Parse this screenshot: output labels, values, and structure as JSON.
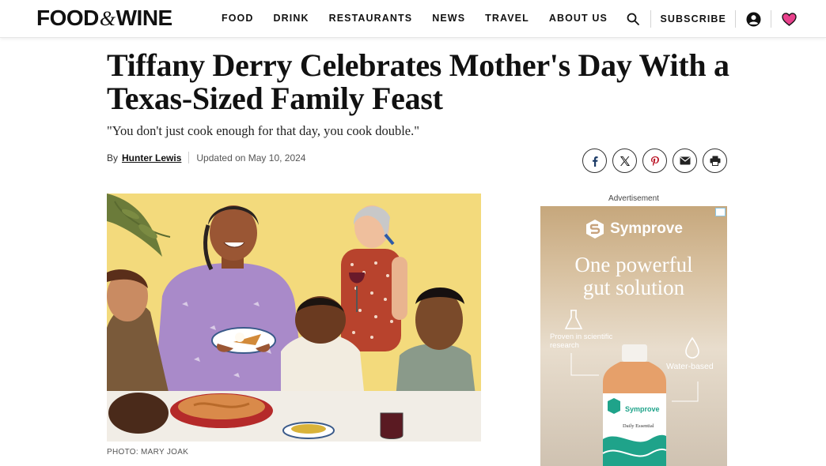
{
  "header": {
    "logo_left": "FOOD",
    "logo_amp": "&",
    "logo_right": "WINE",
    "nav": [
      "FOOD",
      "DRINK",
      "RESTAURANTS",
      "NEWS",
      "TRAVEL",
      "ABOUT US"
    ],
    "subscribe": "SUBSCRIBE",
    "icons": [
      "search-icon",
      "account-icon",
      "heart-icon"
    ],
    "heart_color": "#e8418c"
  },
  "article": {
    "headline": "Tiffany Derry Celebrates Mother's Day With a Texas-Sized Family Feast",
    "dek": "\"You don't just cook enough for that day, you cook double.\"",
    "byline_prefix": "By",
    "author": "Hunter Lewis",
    "updated": "Updated on May 10, 2024",
    "share_icons": [
      "facebook-icon",
      "x-icon",
      "pinterest-icon",
      "email-icon",
      "print-icon"
    ],
    "photo_credit": "PHOTO: MARY JOAK"
  },
  "ad": {
    "label": "Advertisement",
    "brand": "Symprove",
    "headline_line1": "One powerful",
    "headline_line2": "gut solution",
    "feature1": "Proven in scientific research",
    "feature2": "Water-based",
    "bottle_brand": "Symprove",
    "bottle_text": "Daily Essential"
  }
}
